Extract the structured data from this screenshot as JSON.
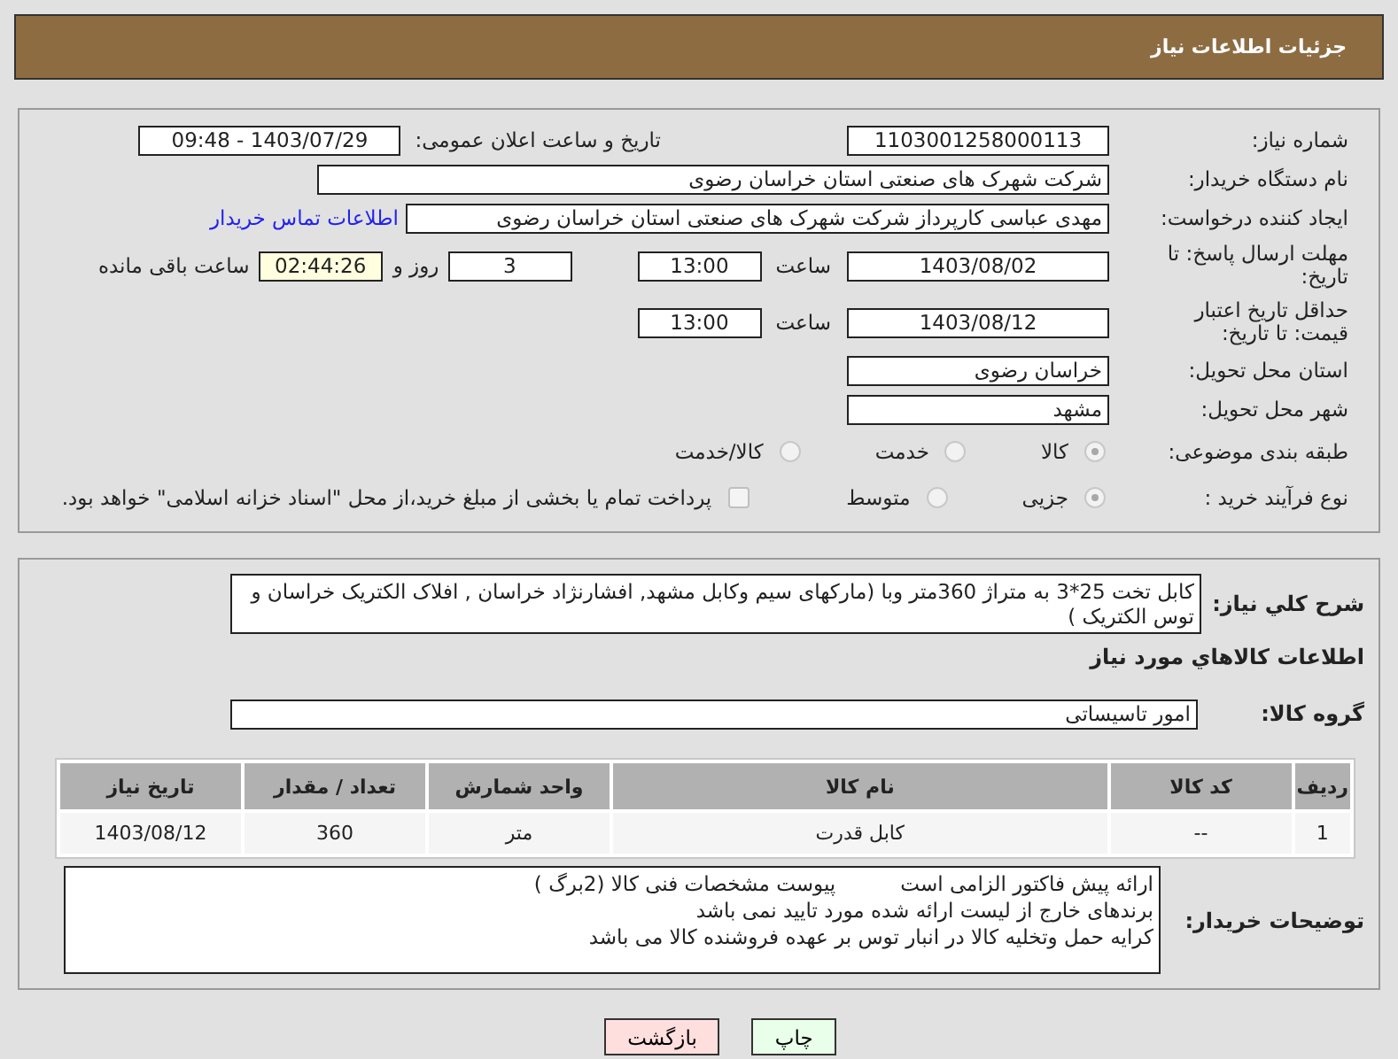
{
  "header": {
    "title": "جزئیات اطلاعات نیاز"
  },
  "need_number": {
    "label": "شماره نیاز:",
    "value": "1103001258000113"
  },
  "announce": {
    "label": "تاریخ و ساعت اعلان عمومی:",
    "value": "1403/07/29 - 09:48"
  },
  "buyer_org": {
    "label": "نام دستگاه خریدار:",
    "value": "شرکت شهرک های صنعتی استان خراسان رضوی"
  },
  "requester": {
    "label": "ایجاد کننده درخواست:",
    "value": "مهدی عباسی کارپرداز شرکت شهرک های صنعتی استان خراسان رضوی",
    "link": "اطلاعات تماس خریدار"
  },
  "response_deadline": {
    "label": "مهلت ارسال پاسخ: تا تاریخ:",
    "date": "1403/08/02",
    "time_label": "ساعت",
    "time": "13:00",
    "days": "3",
    "days_label": "روز و",
    "remaining": "02:44:26",
    "remaining_label": "ساعت باقی مانده"
  },
  "price_validity": {
    "label": "حداقل تاریخ اعتبار قیمت: تا تاریخ:",
    "date": "1403/08/12",
    "time_label": "ساعت",
    "time": "13:00"
  },
  "province": {
    "label": "استان محل تحویل:",
    "value": "خراسان رضوی"
  },
  "city": {
    "label": "شهر محل تحویل:",
    "value": "مشهد"
  },
  "category": {
    "label": "طبقه بندی موضوعی:",
    "options": [
      {
        "label": "کالا",
        "selected": true
      },
      {
        "label": "خدمت",
        "selected": false
      },
      {
        "label": "کالا/خدمت",
        "selected": false
      }
    ]
  },
  "purchase_type": {
    "label": "نوع فرآیند خرید :",
    "options": [
      {
        "label": "جزیی",
        "selected": true
      },
      {
        "label": "متوسط",
        "selected": false
      }
    ],
    "payment_note": {
      "text": "پرداخت تمام یا بخشی از مبلغ خرید،از محل \"اسناد خزانه اسلامی\" خواهد بود.",
      "checked": false
    }
  },
  "description": {
    "label": "شرح کلي نياز:",
    "value": "کابل تخت 25*3  به متراژ 360متر  وبا (مارکهای سیم وکابل مشهد, افشارنژاد خراسان , افلاک الکتریک خراسان و توس الکتریک )"
  },
  "items_heading": "اطلاعات کالاهاي مورد نياز",
  "goods_group": {
    "label": "گروه کالا:",
    "value": "امور تاسیساتی"
  },
  "table": {
    "columns": [
      "ردیف",
      "کد کالا",
      "نام کالا",
      "واحد شمارش",
      "تعداد / مقدار",
      "تاریخ نیاز"
    ],
    "rows": [
      {
        "cells": [
          "1",
          "--",
          "کابل قدرت",
          "متر",
          "360",
          "1403/08/12"
        ]
      }
    ]
  },
  "buyer_notes": {
    "label": "توضیحات خریدار:",
    "lines": [
      "ارائه پیش فاکتور الزامی است          پیوست مشخصات فنی کالا (2برگ )",
      "برندهای خارج از لیست ارائه شده مورد تایید نمی باشد",
      "کرایه حمل وتخلیه کالا در انبار توس بر عهده فروشنده کالا می باشد"
    ]
  },
  "buttons": [
    {
      "label": "چاپ",
      "kind": "print"
    },
    {
      "label": "بازگشت",
      "kind": "back"
    }
  ]
}
